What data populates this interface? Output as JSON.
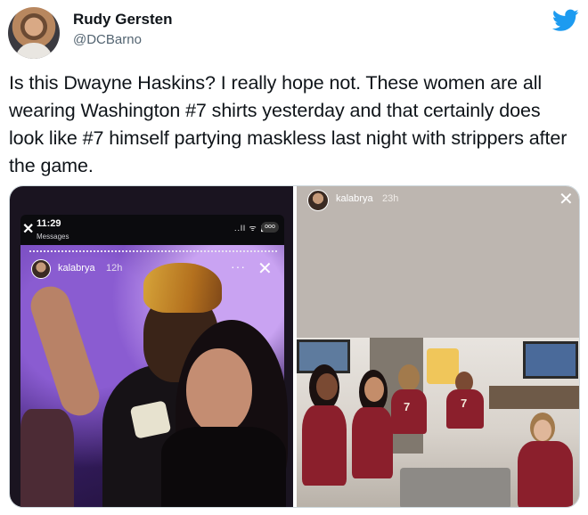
{
  "tweet": {
    "author_name": "Rudy Gersten",
    "author_handle": "@DCBarno",
    "text": "Is this Dwayne Haskins? I really hope not. These women are all wearing Washington #7 shirts yesterday and that certainly does look like #7 himself partying maskless last night with strippers after the game."
  },
  "media": {
    "left": {
      "phone_time": "11:29",
      "phone_subtitle": "Messages",
      "phone_status": "..ll ᯤ ▮",
      "phone_more": "ooo",
      "story_user": "kalabrya",
      "story_age": "12h",
      "story_more": "···",
      "close_glyph": "✕"
    },
    "right": {
      "story_user": "kalabrya",
      "story_age": "23h",
      "close_glyph": "✕",
      "jersey_number": "7"
    }
  },
  "icons": {
    "brand": "twitter-bird-icon",
    "brand_color": "#1d9bf0"
  }
}
